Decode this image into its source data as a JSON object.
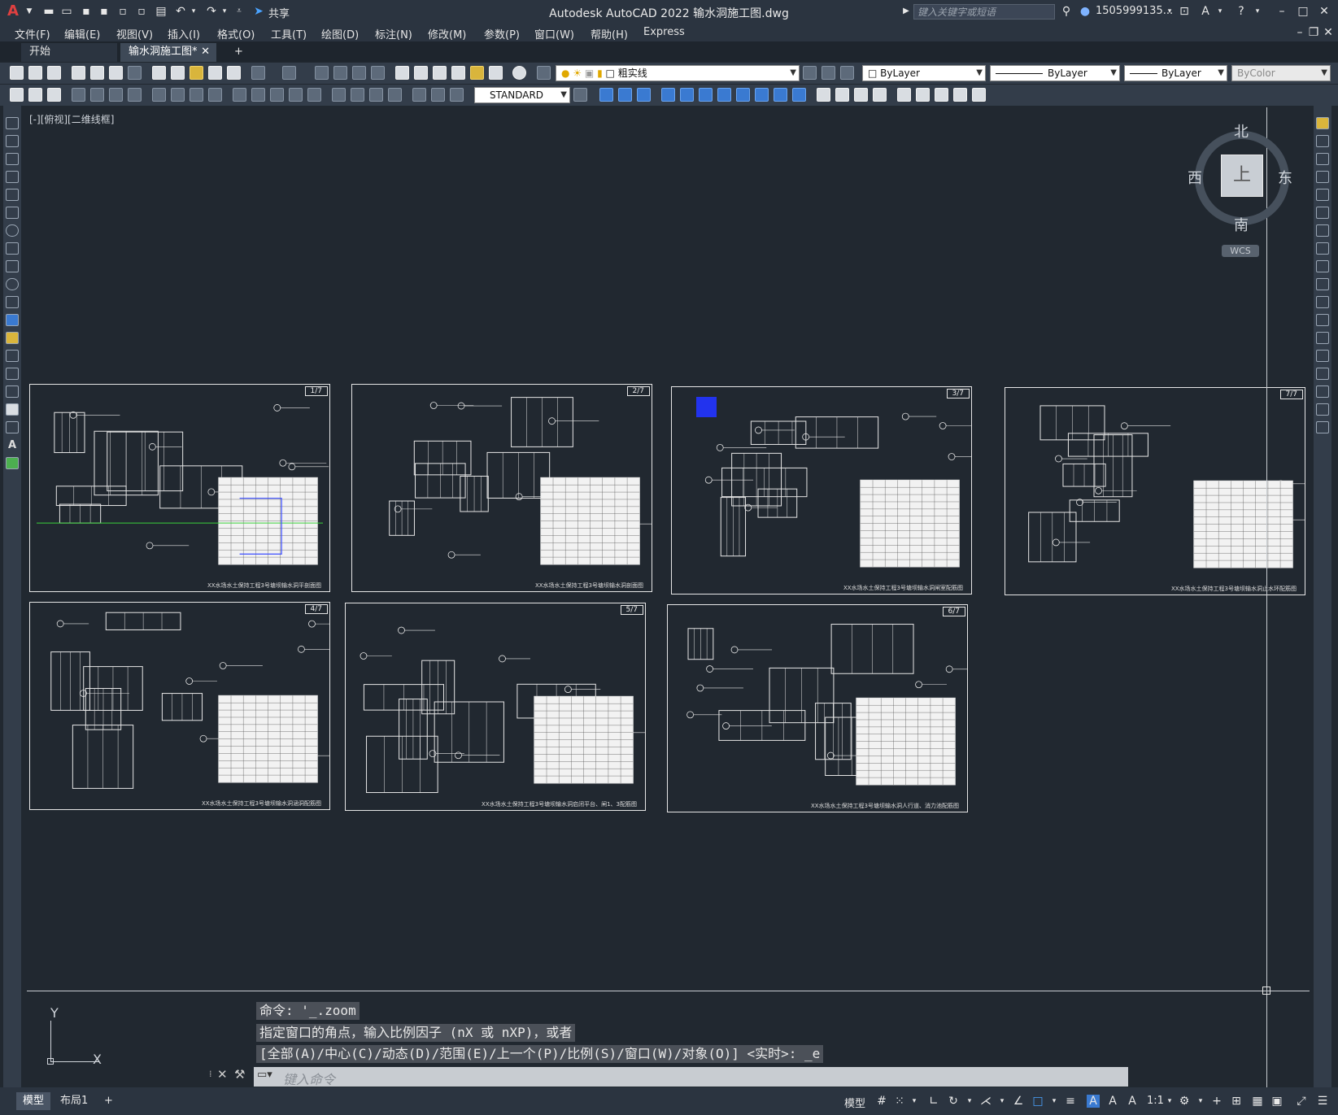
{
  "window": {
    "title": "Autodesk AutoCAD 2022    输水洞施工图.dwg",
    "search_placeholder": "键入关键字或短语",
    "user": "1505999135...",
    "share_label": "共享"
  },
  "menu": [
    "文件(F)",
    "编辑(E)",
    "视图(V)",
    "插入(I)",
    "格式(O)",
    "工具(T)",
    "绘图(D)",
    "标注(N)",
    "修改(M)",
    "参数(P)",
    "窗口(W)",
    "帮助(H)",
    "Express"
  ],
  "tabs": {
    "start": "开始",
    "active": "输水洞施工图*",
    "add": "+"
  },
  "toolbar": {
    "layer_name": "粗实线",
    "color": "ByLayer",
    "linetype": "ByLayer",
    "lineweight": "ByLayer",
    "plotstyle": "ByColor",
    "textstyle": "STANDARD"
  },
  "viewport_label": "[-][俯视][二维线框]",
  "viewcube": {
    "north": "北",
    "south": "南",
    "east": "东",
    "west": "西",
    "top": "上",
    "wcs": "WCS"
  },
  "sheets": [
    {
      "num": "1/7",
      "caption": "XX水场水土保持工程3号塘坝输水洞平剖面图"
    },
    {
      "num": "2/7",
      "caption": "XX水场水土保持工程3号塘坝输水洞剖面图"
    },
    {
      "num": "3/7",
      "caption": "XX水场水土保持工程3号塘坝输水洞闸室配筋图"
    },
    {
      "num": "7/7",
      "caption": "XX水场水土保持工程3号塘坝输水洞止水环配筋图"
    },
    {
      "num": "4/7",
      "caption": "XX水场水土保持工程3号塘坝输水洞涵洞配筋图"
    },
    {
      "num": "5/7",
      "caption": "XX水场水土保持工程3号塘坝输水洞启闭平台、闸1、3配筋图"
    },
    {
      "num": "6/7",
      "caption": "XX水场水土保持工程3号塘坝输水洞人行道、消力池配筋图"
    }
  ],
  "ucs": {
    "x": "X",
    "y": "Y"
  },
  "command": {
    "history": [
      "命令: '_.zoom",
      "指定窗口的角点，输入比例因子 (nX 或 nXP)，或者",
      "[全部(A)/中心(C)/动态(D)/范围(E)/上一个(P)/比例(S)/窗口(W)/对象(O)] <实时>: _e"
    ],
    "input_placeholder": "键入命令"
  },
  "status": {
    "tabs": [
      "模型",
      "布局1",
      "+"
    ],
    "model_label": "模型",
    "scale": "1:1"
  }
}
